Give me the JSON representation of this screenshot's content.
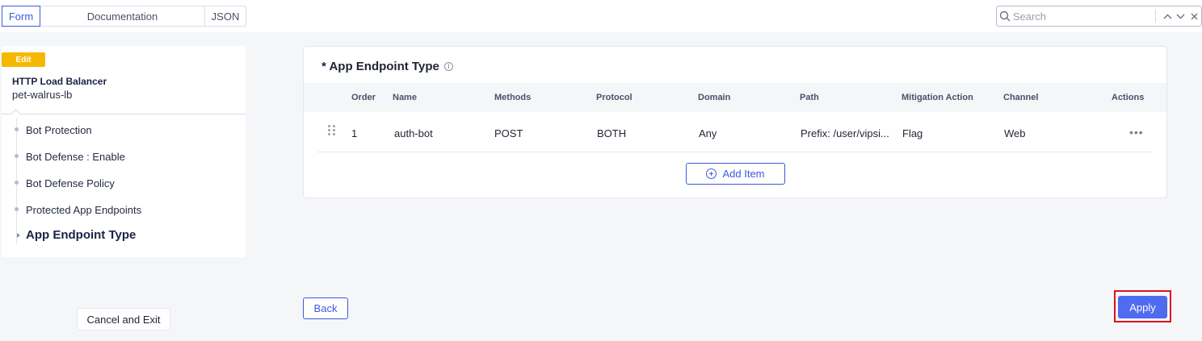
{
  "tabs": [
    {
      "label": "Form",
      "active": true
    },
    {
      "label": "Documentation",
      "active": false
    },
    {
      "label": "JSON",
      "active": false
    }
  ],
  "search": {
    "placeholder": "Search",
    "value": ""
  },
  "left": {
    "badge": "Edit",
    "title": "HTTP Load Balancer",
    "name": "pet-walrus-lb",
    "nav": [
      {
        "label": "Bot Protection"
      },
      {
        "label": "Bot Defense : Enable"
      },
      {
        "label": "Bot Defense Policy"
      },
      {
        "label": "Protected App Endpoints"
      },
      {
        "label": "App Endpoint Type",
        "active": true
      }
    ]
  },
  "card": {
    "title": "* App Endpoint Type",
    "columns": [
      "Order",
      "Name",
      "Methods",
      "Protocol",
      "Domain",
      "Path",
      "Mitigation Action",
      "Channel",
      "Actions"
    ],
    "rows": [
      {
        "order": "1",
        "name": "auth-bot",
        "methods": "POST",
        "protocol": "BOTH",
        "domain": "Any",
        "path": "Prefix: /user/vipsi...",
        "mitigation": "Flag",
        "channel": "Web"
      }
    ],
    "add_label": "Add Item"
  },
  "footer": {
    "cancel_label": "Cancel and Exit",
    "back_label": "Back",
    "apply_label": "Apply"
  },
  "colors": {
    "accent": "#3b5bdb",
    "apply": "#4f6bf0",
    "badge": "#f5b800",
    "highlight": "#e0101c"
  }
}
